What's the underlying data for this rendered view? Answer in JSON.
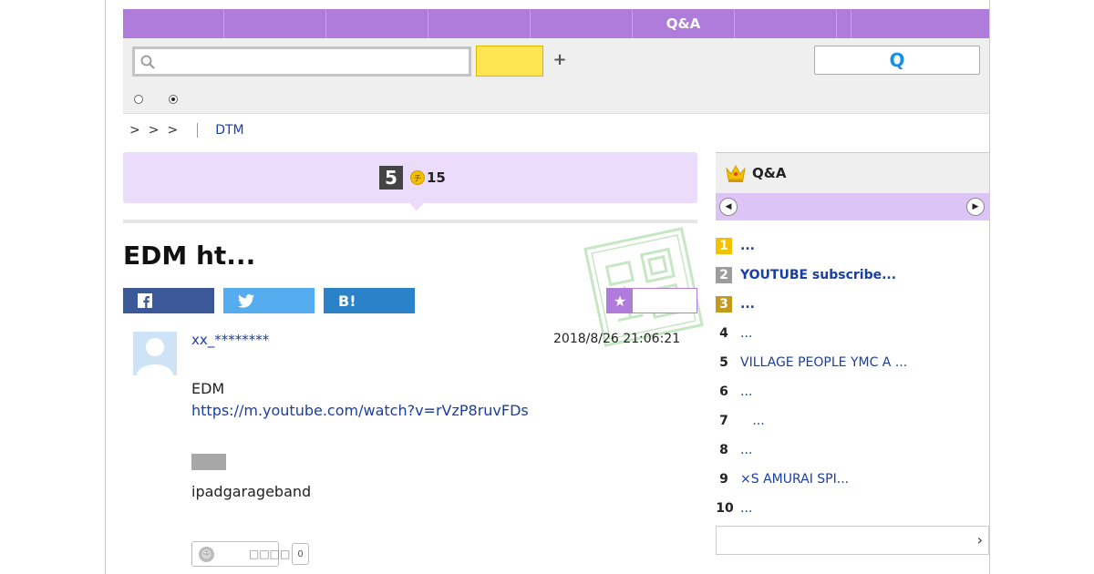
{
  "nav": {
    "items": [
      "",
      "",
      "",
      "",
      "",
      "Q&A",
      "",
      "",
      ""
    ]
  },
  "search": {
    "placeholder": "",
    "value": "",
    "plus_label": "+",
    "qa_button_label": "Q"
  },
  "breadcrumb": {
    "separators": [
      ">",
      ">",
      ">"
    ],
    "category": "DTM"
  },
  "question": {
    "answer_count": "5",
    "coin_symbol": "チ",
    "coin_value": "15",
    "title": "EDM ht...",
    "share": {
      "facebook": "f",
      "twitter": "t",
      "hatena": "B!"
    },
    "favorite_icon": "★",
    "user": "xx_********",
    "date": "2018/8/26  21:06:21",
    "body_line1": "EDM",
    "link": "https://m.youtube.com/watch?v=rVzP8ruvFDs",
    "body_line2": "ipadgarageband",
    "like_label": "□□□□",
    "like_count": "0"
  },
  "ranking": {
    "title": "Q&A",
    "items": [
      {
        "rank": "1",
        "text": "..."
      },
      {
        "rank": "2",
        "text": "YOUTUBE subscribe..."
      },
      {
        "rank": "3",
        "text": "..."
      },
      {
        "rank": "4",
        "text": "..."
      },
      {
        "rank": "5",
        "text": "VILLAGE PEOPLE  YMC  A ..."
      },
      {
        "rank": "6",
        "text": "..."
      },
      {
        "rank": "7",
        "text": "   ..."
      },
      {
        "rank": "8",
        "text": "..."
      },
      {
        "rank": "9",
        "text": "×S  AMURAI SPI..."
      },
      {
        "rank": "10",
        "text": "..."
      }
    ],
    "more_icon": "›"
  },
  "colors": {
    "nav": "#b07cdc",
    "coin_box": "#ecdcfb",
    "ranking_tabs": "#dcc4f6",
    "search_button": "#ffe552",
    "link": "#1a3fa0",
    "facebook": "#3b5998",
    "twitter": "#55acee",
    "hatena": "#2c82c9"
  }
}
